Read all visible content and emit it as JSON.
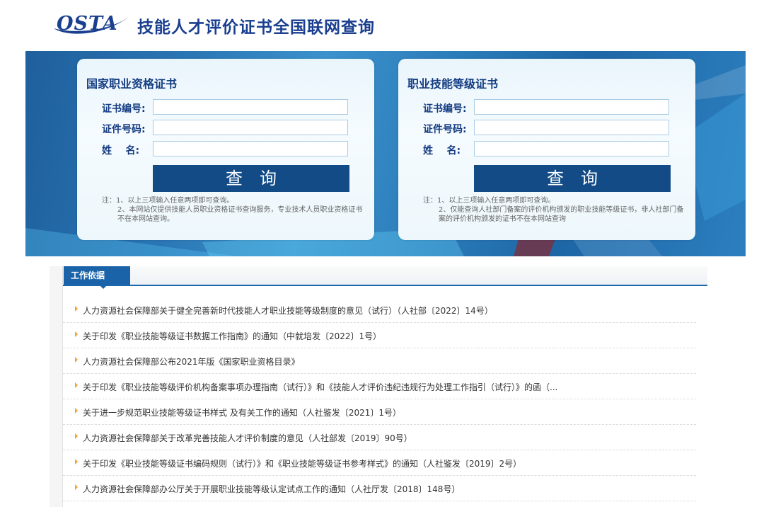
{
  "header": {
    "logo_text": "OSTA",
    "title": "技能人才评价证书全国联网查询"
  },
  "cards": [
    {
      "title": "国家职业资格证书",
      "fields": [
        {
          "label": "证书编号:",
          "value": ""
        },
        {
          "label": "证件号码:",
          "value": ""
        },
        {
          "label": "姓    名:",
          "value": ""
        }
      ],
      "button": "查询",
      "note_1": "注：1、以上三项输入任意两项即可查询。",
      "note_2": "2、本网站仅提供技能人员职业资格证书查询服务，专业技术人员职业资格证书不在本网站查询。"
    },
    {
      "title": "职业技能等级证书",
      "fields": [
        {
          "label": "证书编号:",
          "value": ""
        },
        {
          "label": "证件号码:",
          "value": ""
        },
        {
          "label": "姓    名:",
          "value": ""
        }
      ],
      "button": "查询",
      "note_1": "注：1、以上三项输入任意两项即可查询。",
      "note_2": "2、仅能查询人社部门备案的评价机构颁发的职业技能等级证书，非人社部门备案的评价机构颁发的证书不在本网站查询"
    }
  ],
  "work_basis": {
    "tab_label": "工作依据",
    "items": [
      "人力资源社会保障部关于健全完善新时代技能人才职业技能等级制度的意见（试行）（人社部〔2022〕14号）",
      "关于印发《职业技能等级证书数据工作指南》的通知（中就培发〔2022〕1号）",
      "人力资源社会保障部公布2021年版《国家职业资格目录》",
      "关于印发《职业技能等级评价机构备案事项办理指南（试行）》和《技能人才评价违纪违规行为处理工作指引（试行）》的函（...",
      "关于进一步规范职业技能等级证书样式 及有关工作的通知（人社鉴发〔2021〕1号）",
      "人力资源社会保障部关于改革完善技能人才评价制度的意见（人社部发〔2019〕90号）",
      "关于印发《职业技能等级证书编码规则（试行）》和《职业技能等级证书参考样式》的通知（人社鉴发〔2019〕2号）",
      "人力资源社会保障部办公厅关于开展职业技能等级认定试点工作的通知（人社厅发〔2018〕148号）"
    ]
  },
  "colors": {
    "brand": "#1a3f8f",
    "button": "#134b87",
    "tab": "#1b63a8",
    "bullet": "#f2a33a"
  }
}
